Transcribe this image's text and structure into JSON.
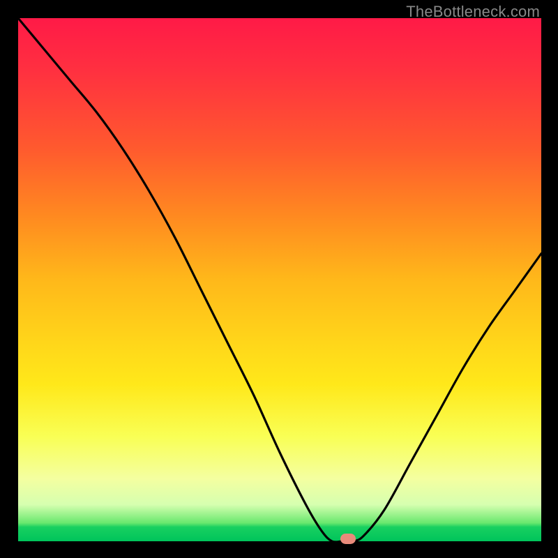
{
  "watermark": "TheBottleneck.com",
  "colors": {
    "background_outer": "#000000",
    "gradient_top": "#ff1a47",
    "gradient_mid": "#ffd61a",
    "gradient_bottom": "#00c45b",
    "curve_stroke": "#000000",
    "gap_marker": "#e98b7b"
  },
  "chart_data": {
    "type": "line",
    "title": "",
    "xlabel": "",
    "ylabel": "",
    "xlim": [
      0,
      100
    ],
    "ylim": [
      0,
      100
    ],
    "series": [
      {
        "name": "bottleneck-curve",
        "x": [
          0,
          5,
          10,
          15,
          20,
          25,
          30,
          35,
          40,
          45,
          50,
          55,
          58,
          60,
          62,
          64,
          66,
          70,
          75,
          80,
          85,
          90,
          95,
          100
        ],
        "y": [
          100,
          94,
          88,
          82,
          75,
          67,
          58,
          48,
          38,
          28,
          17,
          7,
          2,
          0,
          0,
          0,
          1,
          6,
          15,
          24,
          33,
          41,
          48,
          55
        ]
      }
    ],
    "gap_marker_x": 63,
    "annotations": []
  }
}
